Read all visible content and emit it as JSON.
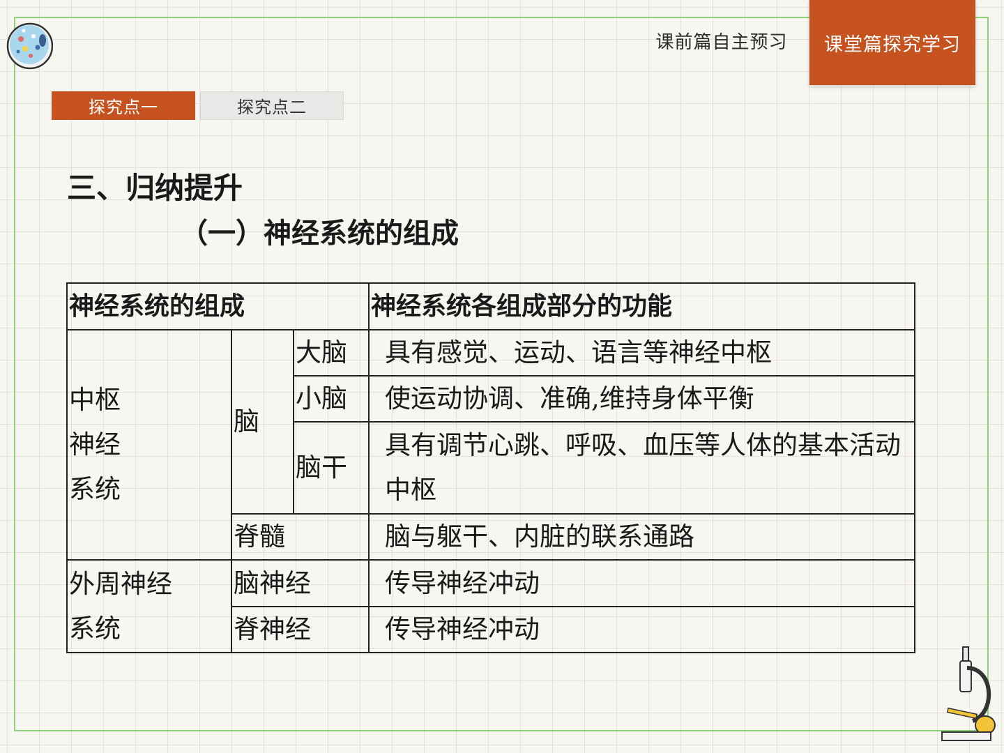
{
  "nav": {
    "pre_lesson": "课前篇自主预习",
    "in_class": "课堂篇探究学习"
  },
  "tabs": [
    "探究点一",
    "探究点二"
  ],
  "heading": "三、归纳提升",
  "subheading": "（一）神经系统的组成",
  "table": {
    "header": {
      "composition": "神经系统的组成",
      "function": "神经系统各组成部分的功能"
    },
    "central": {
      "label_lines": [
        "中枢",
        "神经",
        "系统"
      ],
      "brain": "脑",
      "cerebrum": {
        "name": "大脑",
        "function": "具有感觉、运动、语言等神经中枢"
      },
      "cerebellum": {
        "name": "小脑",
        "function": "使运动协调、准确,维持身体平衡"
      },
      "brainstem": {
        "name": "脑干",
        "function": "具有调节心跳、呼吸、血压等人体的基本活动中枢"
      },
      "spinal_cord": {
        "name": "脊髓",
        "function": "脑与躯干、内脏的联系通路"
      }
    },
    "peripheral": {
      "label_lines": [
        "外周神经",
        "系统"
      ],
      "cranial": {
        "name": "脑神经",
        "function": "传导神经冲动"
      },
      "spinal": {
        "name": "脊神经",
        "function": "传导神经冲动"
      }
    }
  },
  "colors": {
    "accent": "#c5521f",
    "frame": "#8fcf7a",
    "background": "#f7f6f1"
  },
  "icons": [
    "petri-dish-logo-icon",
    "microscope-icon"
  ]
}
